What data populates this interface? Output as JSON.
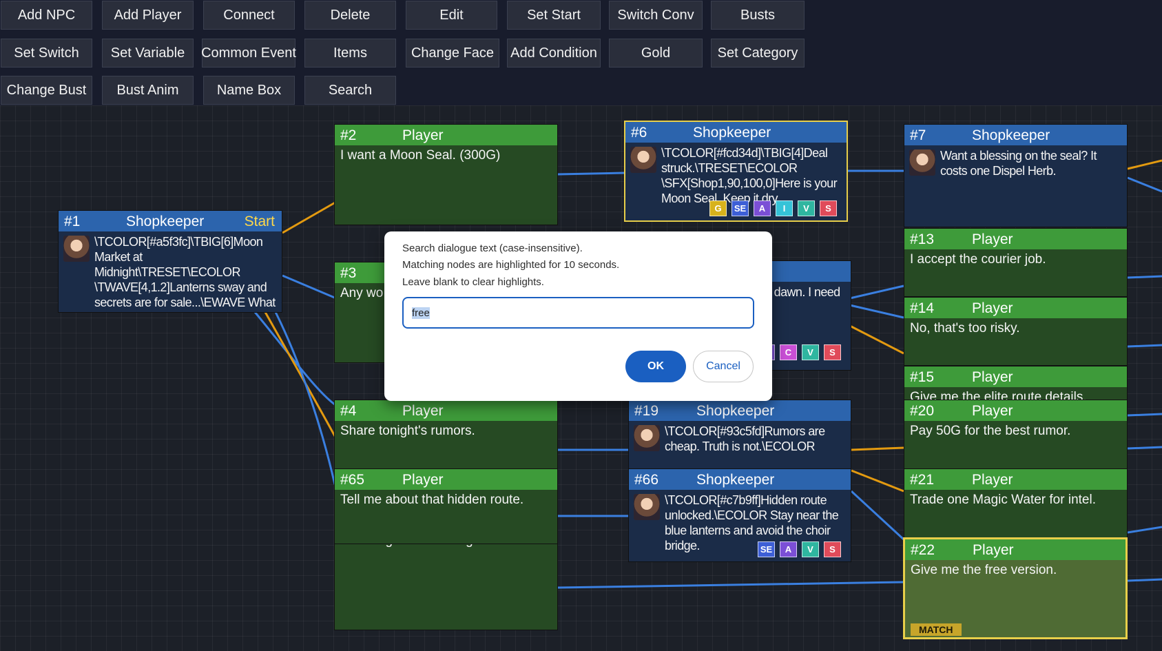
{
  "toolbar": {
    "row1": [
      "Add NPC",
      "Add Player",
      "Connect",
      "Delete",
      "Edit",
      "Set Start",
      "Switch Conv",
      "Busts"
    ],
    "row2": [
      "Set Switch",
      "Set Variable",
      "Common Event",
      "Items",
      "Change Face",
      "Add Condition",
      "Gold",
      "Set Category"
    ],
    "row3": [
      "Change Bust",
      "Bust Anim",
      "Name Box",
      "Search"
    ]
  },
  "colors": {
    "player_header": "#3e9b3a",
    "player_body": "#264a23",
    "npc_header": "#2c64ad",
    "npc_body": "#1b2c48",
    "link_blue": "#3a7fe0",
    "link_orange": "#e39a10",
    "highlight": "#e8cf4a",
    "start_label": "#ffd84a"
  },
  "nodes": {
    "n1": {
      "num": "#1",
      "speaker": "Shopkeeper",
      "start": "Start",
      "text": "\\TCOLOR[#a5f3fc]\\TBIG[6]Moon Market at Midnight\\TRESET\\ECOLOR \\TWAVE[4,1.2]Lanterns sway and secrets are for sale...\\EWAVE What do you need tonight?"
    },
    "n2": {
      "num": "#2",
      "speaker": "Player",
      "text": "I want a Moon Seal. (300G)"
    },
    "n3": {
      "num": "#3",
      "speaker": "",
      "text": "Any wo"
    },
    "n4": {
      "num": "#4",
      "speaker": "Player",
      "text": "Share tonight's rumors."
    },
    "n65": {
      "num": "#65",
      "speaker": "Player",
      "text": "Tell me about that hidden route."
    },
    "n_hidden": {
      "text": "Not tonight. I'm leaving."
    },
    "n6": {
      "num": "#6",
      "speaker": "Shopkeeper",
      "text": "\\TCOLOR[#fcd34d]\\TBIG[4]Deal struck.\\TRESET\\ECOLOR \\SFX[Shop1,90,100,0]Here is your Moon Seal. Keep it dry."
    },
    "n_mid": {
      "speaker": "r",
      "text": "gent job.\\ECOLOR e dawn. I need a"
    },
    "n19": {
      "num": "#19",
      "speaker": "Shopkeeper",
      "text": "\\TCOLOR[#93c5fd]Rumors are cheap. Truth is not.\\ECOLOR"
    },
    "n66": {
      "num": "#66",
      "speaker": "Shopkeeper",
      "text": "\\TCOLOR[#c7b9ff]Hidden route unlocked.\\ECOLOR Stay near the blue lanterns and avoid the choir bridge."
    },
    "n7": {
      "num": "#7",
      "speaker": "Shopkeeper",
      "text": "Want a blessing on the seal? It costs one Dispel Herb."
    },
    "n13": {
      "num": "#13",
      "speaker": "Player",
      "text": "I accept the courier job."
    },
    "n14": {
      "num": "#14",
      "speaker": "Player",
      "text": "No, that's too risky."
    },
    "n15": {
      "num": "#15",
      "speaker": "Player",
      "text": "Give me the elite route details."
    },
    "n20": {
      "num": "#20",
      "speaker": "Player",
      "text": "Pay 50G for the best rumor."
    },
    "n21": {
      "num": "#21",
      "speaker": "Player",
      "text": "Trade one Magic Water for intel."
    },
    "n22": {
      "num": "#22",
      "speaker": "Player",
      "text": "Give me the free version.",
      "tag": "MATCH"
    }
  },
  "badges": {
    "n6": [
      {
        "label": "G",
        "color": "#d7b21c"
      },
      {
        "label": "SE",
        "color": "#3d5fd6"
      },
      {
        "label": "A",
        "color": "#7b4fd6"
      },
      {
        "label": "I",
        "color": "#35c3d8"
      },
      {
        "label": "V",
        "color": "#2fb6a0"
      },
      {
        "label": "S",
        "color": "#e04b5a"
      }
    ],
    "n_mid": [
      {
        "label": "A",
        "color": "#7b4fd6"
      },
      {
        "label": "C",
        "color": "#c94fd6"
      },
      {
        "label": "V",
        "color": "#2fb6a0"
      },
      {
        "label": "S",
        "color": "#e04b5a"
      }
    ],
    "n66": [
      {
        "label": "SE",
        "color": "#3d5fd6"
      },
      {
        "label": "A",
        "color": "#7b4fd6"
      },
      {
        "label": "V",
        "color": "#2fb6a0"
      },
      {
        "label": "S",
        "color": "#e04b5a"
      }
    ]
  },
  "dialog": {
    "line1": "Search dialogue text (case-insensitive).",
    "line2": "Matching nodes are highlighted for 10 seconds.",
    "line3": "Leave blank to clear highlights.",
    "input_value": "free",
    "ok": "OK",
    "cancel": "Cancel"
  }
}
